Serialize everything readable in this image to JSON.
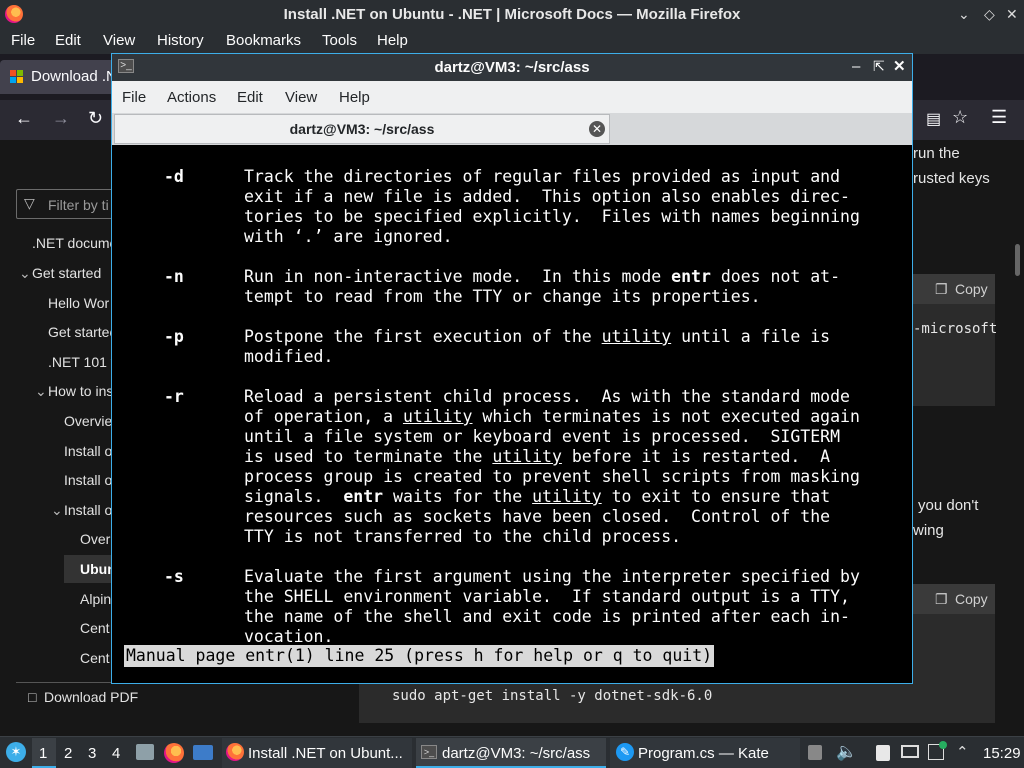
{
  "firefox": {
    "window_title": "Install .NET on Ubuntu - .NET | Microsoft Docs — Mozilla Firefox",
    "menu": [
      "File",
      "Edit",
      "View",
      "History",
      "Bookmarks",
      "Tools",
      "Help"
    ],
    "tab_label": "Download .N",
    "sidebar": {
      "filter_placeholder": "Filter by ti",
      "items": [
        ".NET docume",
        "Get started",
        "Hello Wor",
        "Get startec",
        ".NET 101 v",
        "How to ins",
        "Overvie",
        "Install o",
        "Install o",
        "Install o",
        "Over",
        "Ubun",
        "Alpin",
        "Cent",
        "Cent"
      ],
      "download_pdf": "Download PDF"
    },
    "main": {
      "text_run_the": "run the",
      "text_trusted_keys": "rusted keys",
      "copy_label": "Copy",
      "code1_fragment": "-microsoft",
      "text_you_dont": "you don't",
      "text_wing": "wing",
      "code2_line": "sudo apt-get install -y dotnet-sdk-6.0"
    }
  },
  "konsole": {
    "window_title": "dartz@VM3: ~/src/ass",
    "menu": [
      "File",
      "Actions",
      "Edit",
      "View",
      "Help"
    ],
    "tab_title": "dartz@VM3: ~/src/ass",
    "status_line": "Manual page entr(1) line 25 (press h for help or q to quit)"
  },
  "taskbar": {
    "desktops": [
      "1",
      "2",
      "3",
      "4"
    ],
    "tasks": [
      "Install .NET on Ubunt...",
      "dartz@VM3: ~/src/ass",
      "Program.cs — Kate"
    ],
    "clock": "15:29"
  }
}
